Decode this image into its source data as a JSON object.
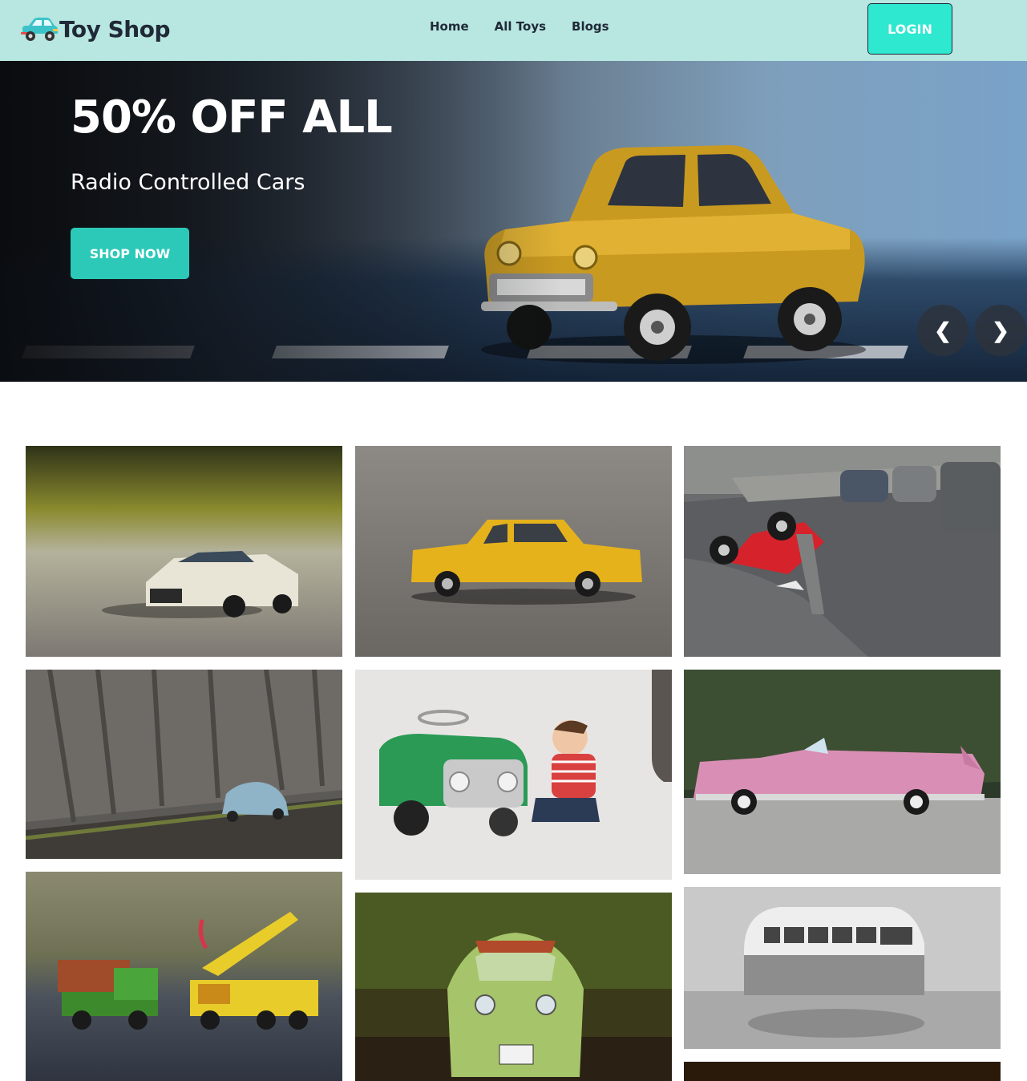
{
  "navbar": {
    "brand": "Toy Shop",
    "brand_icon": "toy-car-icon",
    "links": [
      "Home",
      "All Toys",
      "Blogs"
    ],
    "login_label": "LOGIN",
    "background": "#b8e6e0",
    "accent": "#2ee8d0"
  },
  "hero": {
    "title": "50% OFF ALL",
    "subtitle": "Radio Controlled Cars",
    "cta_label": "SHOP NOW",
    "cta_color": "#2cc9b8",
    "prev_label": "❮",
    "next_label": "❯"
  },
  "gallery": {
    "columns": [
      [
        "lego-white-car",
        "blue-classic-car-on-wood",
        "toy-trucks-crane"
      ],
      [
        "yellow-sedan-on-asphalt",
        "child-with-green-pedal-car",
        "green-bubble-car"
      ],
      [
        "red-toy-car-upside-down",
        "pink-convertible",
        "grayscale-vw-bus",
        "partial-image"
      ]
    ]
  }
}
